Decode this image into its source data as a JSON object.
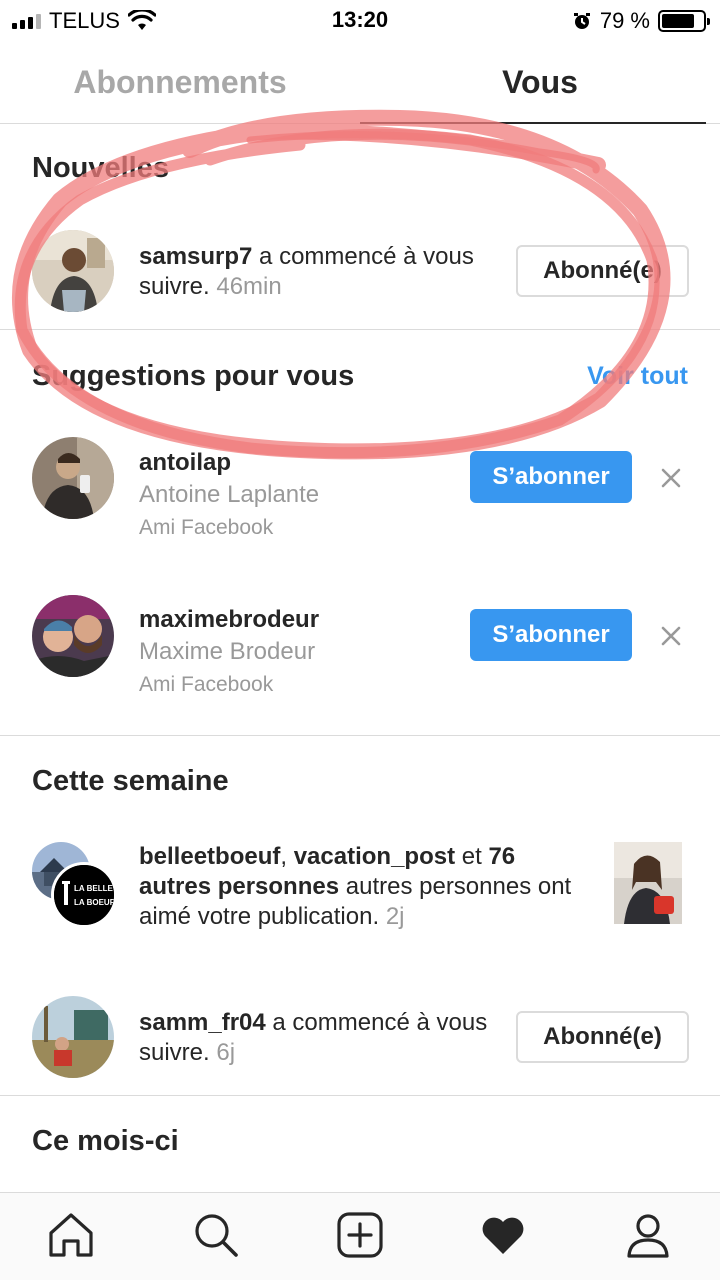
{
  "status_bar": {
    "carrier": "TELUS",
    "time": "13:20",
    "battery": "79 %",
    "battery_level": 0.79
  },
  "tabs": [
    {
      "label": "Abonnements"
    },
    {
      "label": "Vous"
    }
  ],
  "new_section": {
    "title": "Nouvelles",
    "item": {
      "username": "samsurp7",
      "text": " a commencé à vous suivre.",
      "time": "46min",
      "button": "Abonné(e)"
    }
  },
  "suggestions": {
    "title": "Suggestions pour vous",
    "see_all": "Voir tout",
    "items": [
      {
        "username": "antoilap",
        "full_name": "Antoine Laplante",
        "note": "Ami Facebook",
        "button": "S’abonner"
      },
      {
        "username": "maximebrodeur",
        "full_name": "Maxime Brodeur",
        "note": "Ami Facebook",
        "button": "S’abonner"
      }
    ]
  },
  "this_week": {
    "title": "Cette semaine",
    "likes": {
      "user1": "belleetboeuf",
      "sep": ", ",
      "user2": "vacation_post",
      "et": " et ",
      "others": "76 autres personnes",
      "rest": " autres personnes ont aimé votre publication.",
      "time": "2j",
      "logo_line1": "LA BELLE",
      "logo_line2": "LA BOEUF"
    },
    "follow": {
      "username": "samm_fr04",
      "text": " a commencé à vous suivre.",
      "time": "6j",
      "button": "Abonné(e)"
    }
  },
  "this_month": {
    "title": "Ce mois-ci"
  },
  "bottom_nav": [
    "home-icon",
    "search-icon",
    "add-icon",
    "heart-icon",
    "profile-icon"
  ],
  "colors": {
    "accent": "#3897f0",
    "scribble": "#f08080",
    "muted": "#999999"
  }
}
